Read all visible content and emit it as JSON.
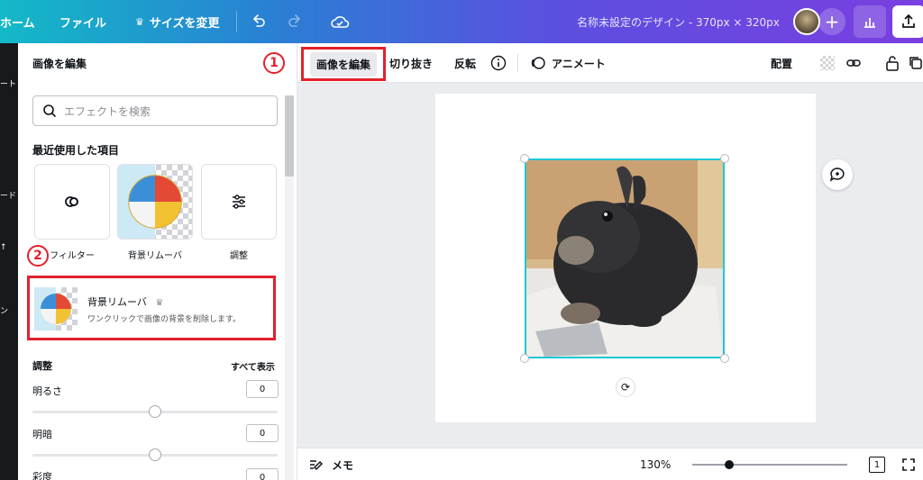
{
  "topbar": {
    "home": "ホーム",
    "file": "ファイル",
    "resize": "サイズを変更",
    "doc_title": "名称未設定のデザイン - 370px × 320px"
  },
  "rail": {
    "items": [
      "ート",
      "ード",
      "ン"
    ]
  },
  "panel": {
    "title": "画像を編集",
    "search_placeholder": "エフェクトを検索",
    "recent_label": "最近使用した項目",
    "tiles": [
      {
        "label": "フィルター",
        "icon": "filter-icon"
      },
      {
        "label": "背景リムーバ",
        "icon": "beach-ball-image"
      },
      {
        "label": "調整",
        "icon": "sliders-icon"
      }
    ],
    "remover": {
      "title": "背景リムーバ",
      "description": "ワンクリックで画像の背景を削除します。"
    },
    "adjust_label": "調整",
    "show_all": "すべて表示",
    "adjustments": [
      {
        "label": "明るさ",
        "value": "0"
      },
      {
        "label": "明暗",
        "value": "0"
      },
      {
        "label": "彩度",
        "value": "0"
      }
    ]
  },
  "annotations": {
    "badge_1": "1",
    "badge_2": "2",
    "accent_color": "#e2212b"
  },
  "context_toolbar": {
    "edit_image": "画像を編集",
    "crop": "切り抜き",
    "flip": "反転",
    "animate": "アニメート",
    "position": "配置"
  },
  "bottombar": {
    "notes": "メモ",
    "zoom": "130%",
    "page_number": "1"
  },
  "colors": {
    "selection": "#1fc7d4"
  }
}
